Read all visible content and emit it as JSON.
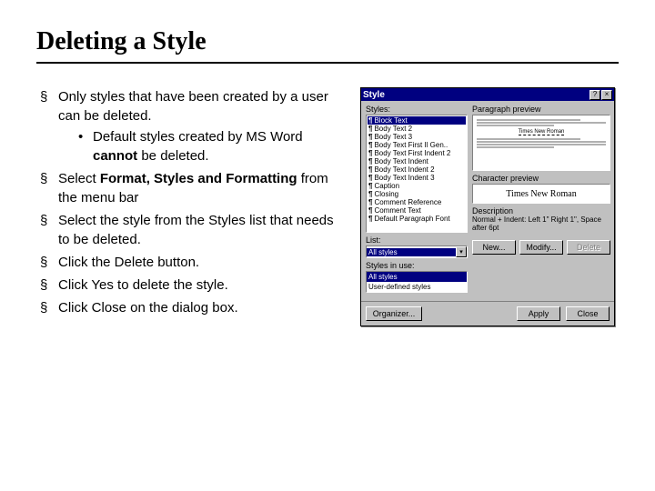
{
  "title": "Deleting a Style",
  "bullets": {
    "b1_pre": "Only styles that have been created by a user can be deleted.",
    "b1_sub_pre": "Default styles created by MS Word ",
    "b1_sub_bold": "cannot",
    "b1_sub_post": " be deleted.",
    "b2_pre": "Select ",
    "b2_bold": "Format, Styles and Formatting",
    "b2_post": " from the menu bar",
    "b3": "Select the style from the Styles list that needs to be deleted.",
    "b4": "Click the Delete button.",
    "b5": "Click Yes to delete the style.",
    "b6": "Click Close on the dialog box."
  },
  "dialog": {
    "title": "Style",
    "help_btn": "?",
    "close_btn": "×",
    "styles_label": "Styles:",
    "styles_items": [
      "Block Text",
      "Body Text 2",
      "Body Text 3",
      "Body Text First Il Gen..",
      "Body Text First Indent 2",
      "Body Text Indent",
      "Body Text Indent 2",
      "Body Text Indent 3",
      "Caption",
      "Closing",
      "Comment Reference",
      "Comment Text",
      "Default Paragraph Font"
    ],
    "selected_style_index": 0,
    "list_label": "List:",
    "list_value": "All styles",
    "style_in_use_label": "Styles in use:",
    "style_in_use_value1": "All styles",
    "style_in_use_value2": "User-defined styles",
    "para_preview_label": "Paragraph preview",
    "para_sample": "Times New Roman",
    "char_preview_label": "Character preview",
    "char_sample": "Times New Roman",
    "desc_label": "Description",
    "desc_text": "Normal + Indent: Left 1\" Right 1\", Space after 6pt",
    "btn_new": "New...",
    "btn_modify": "Modify...",
    "btn_delete": "Delete",
    "btn_organizer": "Organizer...",
    "btn_apply": "Apply",
    "btn_close": "Close"
  }
}
